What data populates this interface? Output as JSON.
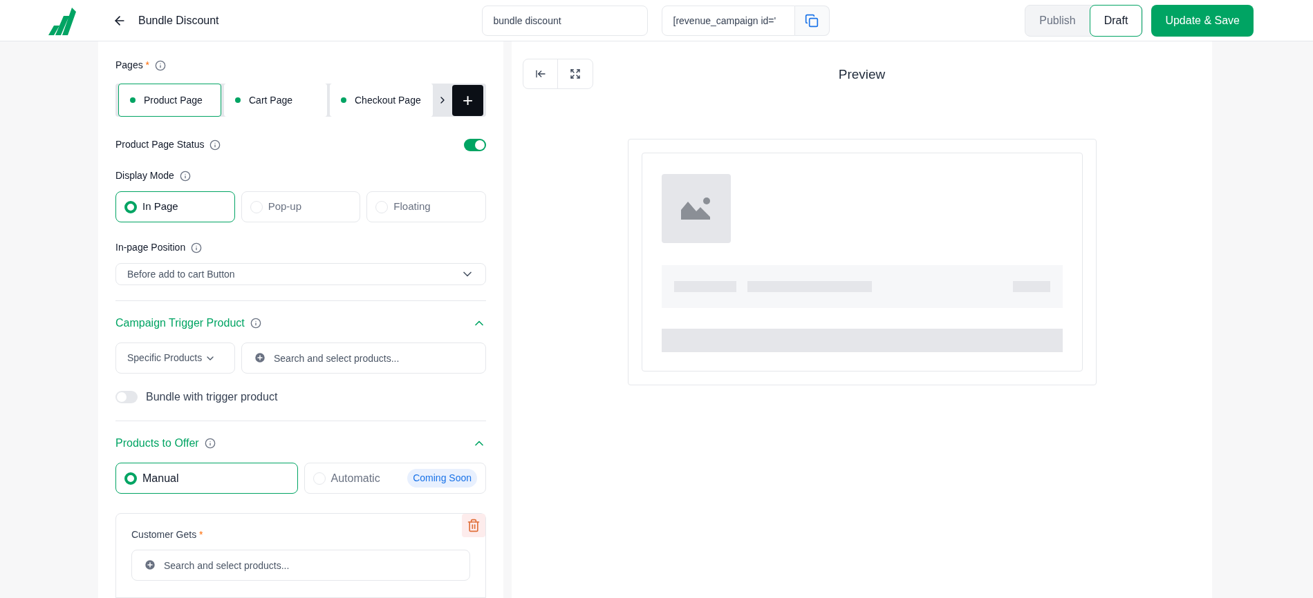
{
  "header": {
    "title": "Bundle Discount",
    "name_field": {
      "value": "bundle discount"
    },
    "shortcode_field": {
      "value": "[revenue_campaign id='"
    },
    "status_tabs": [
      {
        "label": "Publish",
        "selected": false
      },
      {
        "label": "Draft",
        "selected": true
      }
    ],
    "save_button": "Update & Save"
  },
  "pages": {
    "label": "Pages",
    "required": "*",
    "tabs": [
      {
        "label": "Product Page",
        "selected": true
      },
      {
        "label": "Cart Page",
        "selected": false
      },
      {
        "label": "Checkout Page",
        "selected": false
      }
    ],
    "add_button": "+"
  },
  "page_status": {
    "label": "Product Page Status",
    "on": true
  },
  "display_mode": {
    "label": "Display Mode",
    "options": [
      {
        "label": "In Page",
        "selected": true
      },
      {
        "label": "Pop-up",
        "selected": false
      },
      {
        "label": "Floating",
        "selected": false
      }
    ]
  },
  "position": {
    "label": "In-page Position",
    "value": "Before add to cart Button"
  },
  "trigger": {
    "title": "Campaign Trigger Product",
    "expanded": true,
    "scope": "Specific Products",
    "search": {
      "placeholder": "Search and select products..."
    },
    "bundle_toggle": {
      "label": "Bundle with trigger product",
      "on": false
    }
  },
  "offer": {
    "title": "Products to Offer",
    "expanded": true,
    "options": [
      {
        "label": "Manual",
        "selected": true
      },
      {
        "label": "Automatic",
        "selected": false,
        "badge": "Coming Soon"
      }
    ],
    "customer_gets": {
      "label": "Customer Gets",
      "required": "*",
      "search": {
        "placeholder": "Search and select products..."
      }
    }
  },
  "preview": {
    "title": "Preview"
  }
}
